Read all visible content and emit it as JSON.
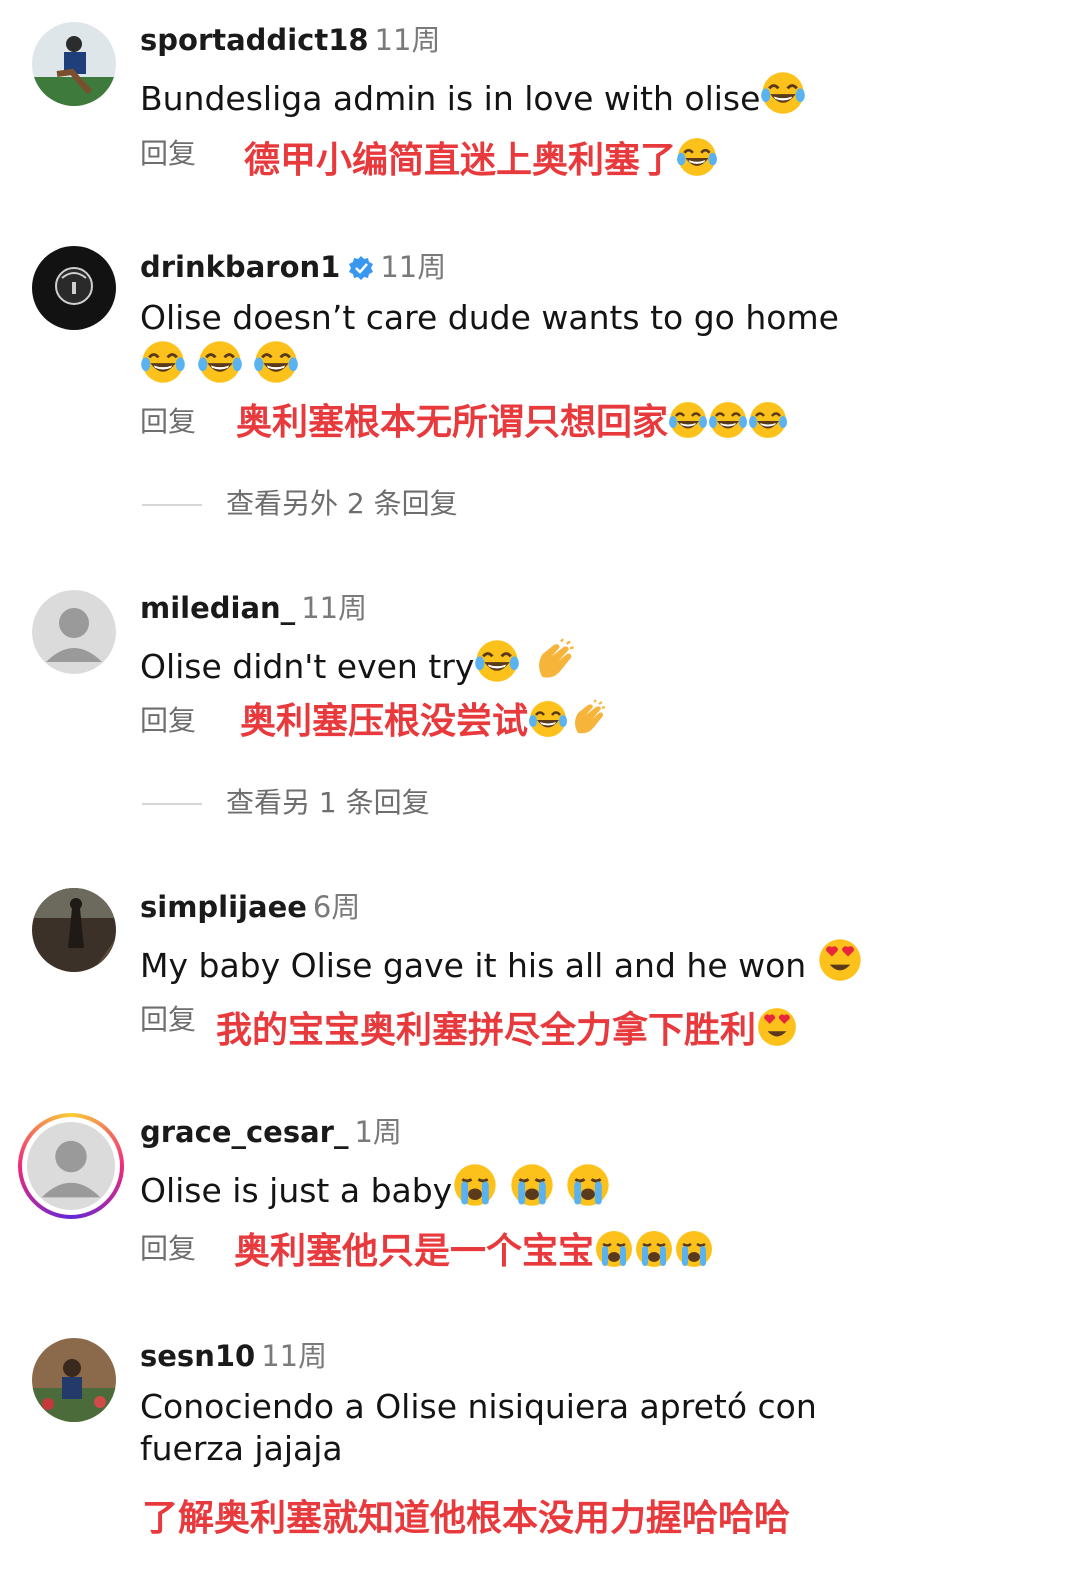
{
  "reply_label": "回复",
  "comments": [
    {
      "username": "sportaddict18",
      "time": "11周",
      "text": "Bundesliga admin is in love with olise",
      "translation": "德甲小编简直迷上奥利塞了"
    },
    {
      "username": "drinkbaron1",
      "verified": true,
      "time": "11周",
      "text": "Olise doesn’t care dude wants to go home",
      "translation": "奥利塞根本无所谓只想回家",
      "view_more": "查看另外 2 条回复"
    },
    {
      "username": "miledian_",
      "time": "11周",
      "text": "Olise didn't even try",
      "translation": "奥利塞压根没尝试",
      "view_more": "查看另 1 条回复"
    },
    {
      "username": "simplijaee",
      "time": "6周",
      "text": "My baby Olise gave it his all and he won",
      "translation": "我的宝宝奥利塞拼尽全力拿下胜利"
    },
    {
      "username": "grace_cesar_",
      "time": "1周",
      "text": "Olise is just a baby",
      "translation": "奥利塞他只是一个宝宝"
    },
    {
      "username": "sesn10",
      "time": "11周",
      "text": "Conociendo a Olise nisiquiera apretó con fuerza jajaja",
      "translation": "了解奥利塞就知道他根本没用力握哈哈哈"
    }
  ],
  "colors": {
    "translation": "#e8393d",
    "muted": "#6e6e6e",
    "verified": "#3897f0"
  }
}
